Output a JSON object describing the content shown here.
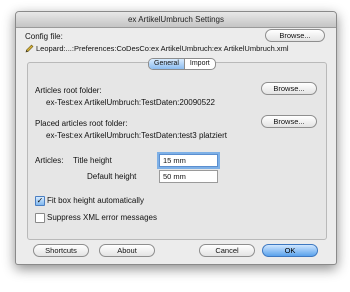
{
  "window": {
    "title": "ex ArtikelUmbruch Settings"
  },
  "config": {
    "label": "Config file:",
    "path": "Leopard:...:Preferences:CoDesCo:ex ArtikelUmbruch:ex ArtikelUmbruch.xml",
    "browse_label": "Browse..."
  },
  "tabs": [
    {
      "label": "General",
      "active": true
    },
    {
      "label": "Import",
      "active": false
    }
  ],
  "articles_root": {
    "label": "Articles root folder:",
    "path": "ex-Test:ex ArtikelUmbruch:TestDaten:20090522",
    "browse_label": "Browse..."
  },
  "placed_root": {
    "label": "Placed articles root folder:",
    "path": "ex-Test:ex ArtikelUmbruch:TestDaten:test3 platziert",
    "browse_label": "Browse..."
  },
  "articles": {
    "label": "Articles:",
    "title_height_label": "Title height",
    "title_height_value": "15 mm",
    "default_height_label": "Default height",
    "default_height_value": "50 mm"
  },
  "options": {
    "fit_box_label": "Fit box height automatically",
    "fit_box_checked": true,
    "suppress_xml_label": "Suppress XML error messages",
    "suppress_xml_checked": false
  },
  "buttons": {
    "shortcuts": "Shortcuts",
    "about": "About",
    "cancel": "Cancel",
    "ok": "OK"
  },
  "colors": {
    "accent": "#5aa2ec"
  }
}
